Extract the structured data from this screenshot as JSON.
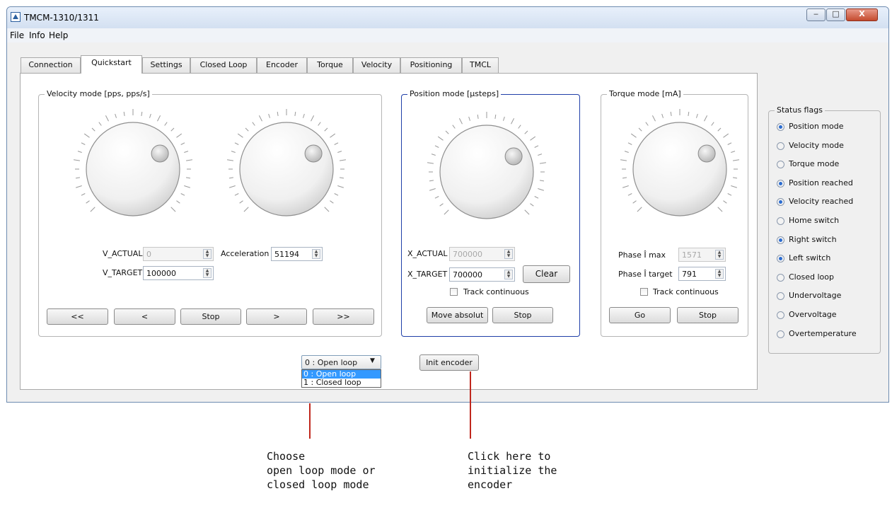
{
  "window": {
    "title": "TMCM-1310/1311",
    "buttons": {
      "minimize": "‒",
      "maximize": "□",
      "close": "X"
    }
  },
  "menu": [
    "File",
    "Info",
    "Help"
  ],
  "tabs": [
    "Connection",
    "Quickstart",
    "Settings",
    "Closed Loop",
    "Encoder",
    "Torque",
    "Velocity",
    "Positioning",
    "TMCL"
  ],
  "active_tab": "Quickstart",
  "velocity_mode": {
    "title": "Velocity mode [pps, pps/s]",
    "v_actual_label": "V_ACTUAL",
    "v_actual_value": "0",
    "acceleration_label": "Acceleration",
    "acceleration_value": "51194",
    "v_target_label": "V_TARGET",
    "v_target_value": "100000",
    "buttons": [
      "<<",
      "<",
      "Stop",
      ">",
      ">>"
    ]
  },
  "position_mode": {
    "title": "Position mode [µsteps]",
    "x_actual_label": "X_ACTUAL",
    "x_actual_value": "700000",
    "x_target_label": "X_TARGET",
    "x_target_value": "700000",
    "clear_label": "Clear",
    "track_label": "Track continuous",
    "move_label": "Move absolut",
    "stop_label": "Stop"
  },
  "torque_mode": {
    "title": "Torque mode [mA]",
    "phase_max_label": "Phase Î max",
    "phase_max_value": "1571",
    "phase_target_label": "Phase Î target",
    "phase_target_value": "791",
    "track_label": "Track continuous",
    "go_label": "Go",
    "stop_label": "Stop"
  },
  "loop_select": {
    "value": "0 : Open loop",
    "options": [
      "0 : Open loop",
      "1 : Closed loop"
    ],
    "selected_option": "0 : Open loop"
  },
  "init_encoder_label": "Init encoder",
  "status_flags": {
    "title": "Status flags",
    "items": [
      {
        "label": "Position mode",
        "on": true
      },
      {
        "label": "Velocity mode",
        "on": false
      },
      {
        "label": "Torque mode",
        "on": false
      },
      {
        "label": "Position reached",
        "on": true
      },
      {
        "label": "Velocity reached",
        "on": true
      },
      {
        "label": "Home switch",
        "on": false
      },
      {
        "label": "Right switch",
        "on": true
      },
      {
        "label": "Left switch",
        "on": true
      },
      {
        "label": "Closed loop",
        "on": false
      },
      {
        "label": "Undervoltage",
        "on": false
      },
      {
        "label": "Overvoltage",
        "on": false
      },
      {
        "label": "Overtemperature",
        "on": false
      }
    ]
  },
  "annotations": {
    "loop_mode": [
      "Choose",
      "open loop mode or",
      "closed loop mode"
    ],
    "init_encoder": [
      "Click here to",
      "initialize the",
      "encoder"
    ]
  },
  "colors": {
    "accent": "#1f3fa8",
    "callout": "#c0271d",
    "selection": "#3399ff"
  }
}
